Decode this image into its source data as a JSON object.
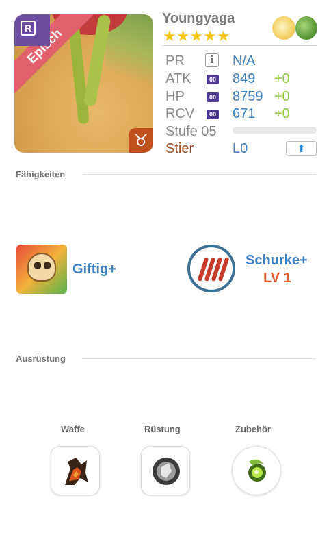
{
  "hero": {
    "name": "Youngyaga",
    "rarity_label": "Episch",
    "rank_badge": "R",
    "stars": "★★★★★",
    "star_count": 5,
    "elements": [
      "light",
      "wood"
    ],
    "zodiac_symbol": "♉"
  },
  "stats": {
    "pr": {
      "label": "PR",
      "value": "N/A"
    },
    "atk": {
      "label": "ATK",
      "badge": "00",
      "value": "849",
      "bonus": "+0"
    },
    "hp": {
      "label": "HP",
      "badge": "00",
      "value": "8759",
      "bonus": "+0"
    },
    "rcv": {
      "label": "RCV",
      "badge": "00",
      "value": "671",
      "bonus": "+0"
    },
    "level": {
      "label": "Stufe 05",
      "progress": 0
    },
    "sign": {
      "label": "Stier",
      "value": "L0"
    }
  },
  "sections": {
    "skills": "Fähigkeiten",
    "equipment": "Ausrüstung"
  },
  "skills": [
    {
      "name": "Giftig+"
    },
    {
      "name": "Schurke+",
      "level": "LV 1"
    }
  ],
  "equipment": [
    {
      "label": "Waffe"
    },
    {
      "label": "Rüstung"
    },
    {
      "label": "Zubehör"
    }
  ],
  "colors": {
    "accent_blue": "#3b7fc4",
    "bonus_green": "#8cc63f",
    "rarity_ribbon": "#e0616a",
    "skill_level": "#e0592a"
  }
}
